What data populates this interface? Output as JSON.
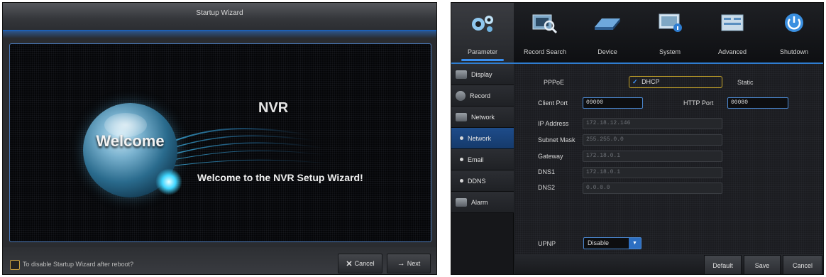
{
  "wizard": {
    "title": "Startup Wizard",
    "logo_welcome": "Welcome",
    "product_name": "NVR",
    "welcome_message": "Welcome to the NVR Setup Wizard!",
    "disable_checkbox_label": "To disable Startup Wizard after reboot?",
    "disable_checked": false,
    "cancel_label": "Cancel",
    "next_label": "Next",
    "accent_color": "#1d5fb3"
  },
  "nvr": {
    "top_nav": [
      {
        "label": "Parameter",
        "icon": "gears-icon",
        "active": true
      },
      {
        "label": "Record Search",
        "icon": "magnifier-film-icon",
        "active": false
      },
      {
        "label": "Device",
        "icon": "hard-disk-icon",
        "active": false
      },
      {
        "label": "System",
        "icon": "monitor-info-icon",
        "active": false
      },
      {
        "label": "Advanced",
        "icon": "advanced-panel-icon",
        "active": false
      },
      {
        "label": "Shutdown",
        "icon": "power-icon",
        "active": false
      }
    ],
    "sidebar": [
      {
        "label": "Display",
        "icon": "display-icon",
        "type": "section"
      },
      {
        "label": "Record",
        "icon": "film-reel-icon",
        "type": "section"
      },
      {
        "label": "Network",
        "icon": "network-icon",
        "type": "section"
      },
      {
        "label": "Network",
        "type": "sub",
        "active": true
      },
      {
        "label": "Email",
        "type": "sub"
      },
      {
        "label": "DDNS",
        "type": "sub"
      },
      {
        "label": "Alarm",
        "icon": "alarm-bell-icon",
        "type": "section"
      }
    ],
    "form": {
      "pppoe_label": "PPPoE",
      "dhcp_label": "DHCP",
      "dhcp_checked": true,
      "static_label": "Static",
      "client_port_label": "Client Port",
      "client_port_value": "09000",
      "http_port_label": "HTTP Port",
      "http_port_value": "00080",
      "ip_label": "IP Address",
      "ip_value": "172.18.12.146",
      "subnet_label": "Subnet Mask",
      "subnet_value": "255.255.0.0",
      "gateway_label": "Gateway",
      "gateway_value": "172.18.0.1",
      "dns1_label": "DNS1",
      "dns1_value": "172.18.0.1",
      "dns2_label": "DNS2",
      "dns2_value": "0.0.0.0",
      "upnp_label": "UPNP",
      "upnp_value": "Disable"
    },
    "buttons": {
      "default_label": "Default",
      "save_label": "Save",
      "cancel_label": "Cancel"
    },
    "accent_color": "#2f7dd1",
    "highlight_color": "#c8a628"
  }
}
